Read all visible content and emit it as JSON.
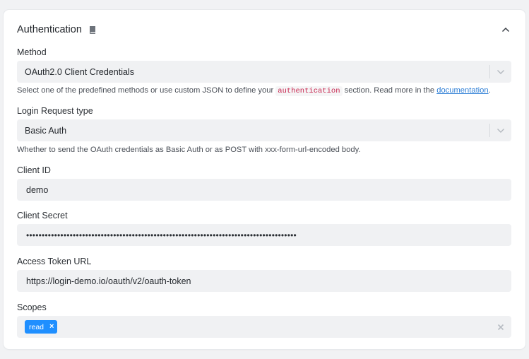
{
  "section": {
    "title": "Authentication",
    "icons": {
      "book": "book-icon",
      "collapse": "chevron-up-icon"
    }
  },
  "method": {
    "label": "Method",
    "value": "OAuth2.0 Client Credentials",
    "help_before": "Select one of the predefined methods or use custom JSON to define your ",
    "help_code": "authentication",
    "help_middle": " section. Read more in the ",
    "help_link": "documentation",
    "help_after": "."
  },
  "login_request": {
    "label": "Login Request type",
    "value": "Basic Auth",
    "help": "Whether to send the OAuth credentials as Basic Auth or as POST with xxx-form-url-encoded body."
  },
  "client_id": {
    "label": "Client ID",
    "value": "demo"
  },
  "client_secret": {
    "label": "Client Secret",
    "value": "•••••••••••••••••••••••••••••••••••••••••••••••••••••••••••••••••••••••••••••••••••••••"
  },
  "access_token_url": {
    "label": "Access Token URL",
    "value": "https://login-demo.io/oauth/v2/oauth-token"
  },
  "scopes": {
    "label": "Scopes",
    "tags": [
      {
        "label": "read",
        "remove": "×"
      }
    ],
    "clear": "×"
  },
  "colors": {
    "accent": "#1f8fff",
    "link": "#2f7fd6",
    "code": "#c8264f",
    "field_bg": "#f0f1f3",
    "page_bg": "#f1f2f4"
  }
}
